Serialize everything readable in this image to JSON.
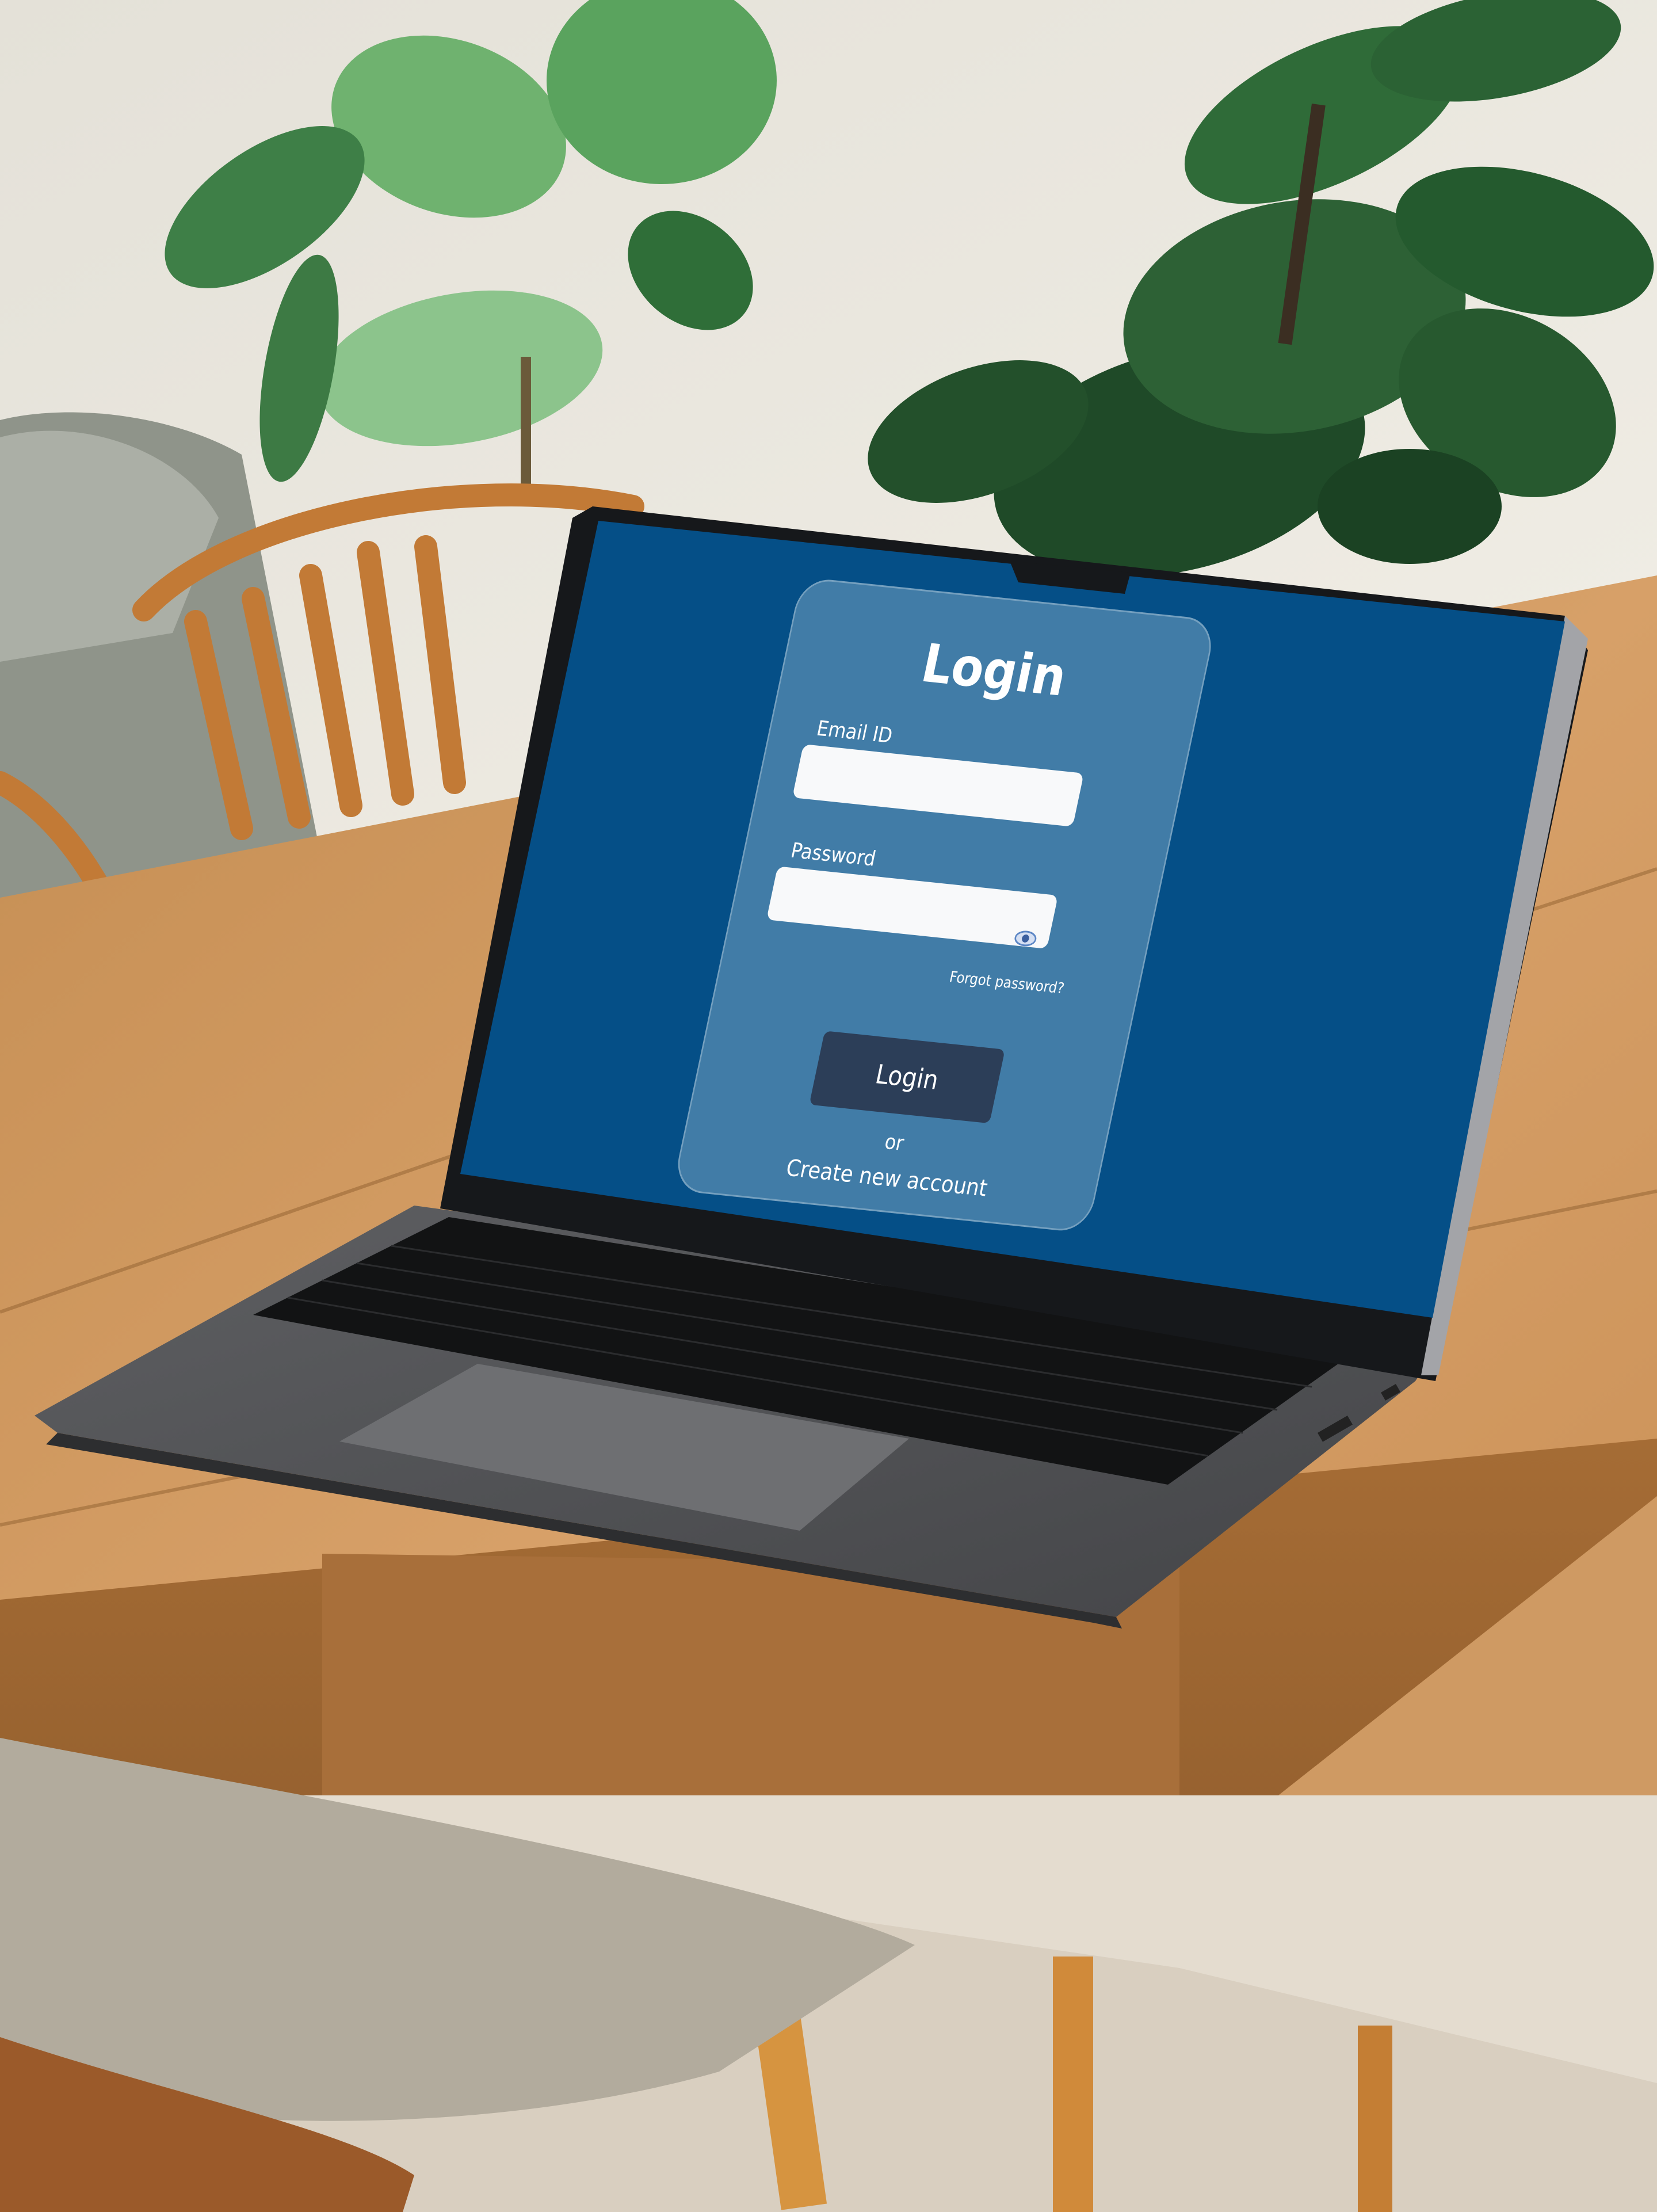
{
  "login": {
    "title": "Login",
    "email_label": "Email ID",
    "email_value": "",
    "password_label": "Password",
    "password_value": "",
    "forgot_password": "Forgot password?",
    "login_button": "Login",
    "or_text": "or",
    "create_account": "Create new account"
  },
  "icons": {
    "password_toggle": "eye-icon"
  },
  "colors": {
    "screen_background": "#054f87",
    "card_background": "#417ca7",
    "button_background": "#2c3e58",
    "input_background": "#f8f9fa",
    "text": "#ffffff",
    "eye_icon": "#5b86c5"
  }
}
